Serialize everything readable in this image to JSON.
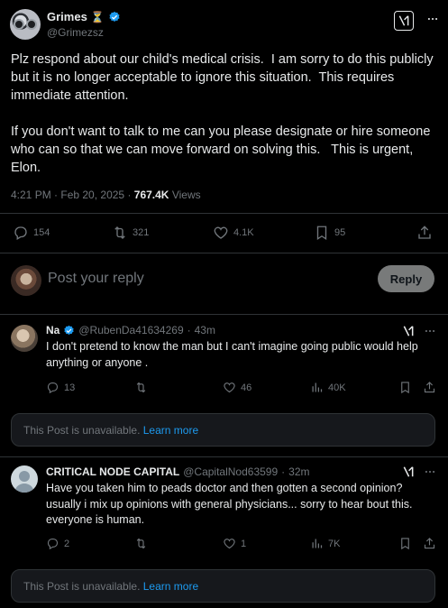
{
  "post": {
    "author_name": "Grimes",
    "author_emoji": "⏳",
    "handle": "@Grimezsz",
    "paragraph1": "Plz respond about our child's medical crisis.  I am sorry to do this publicly but it is no longer acceptable to ignore this situation.  This requires immediate attention.",
    "paragraph2": "If you don't want to talk to me can you please designate or hire someone who can so that we can move forward on solving this.   This is urgent, Elon.",
    "time": "4:21 PM",
    "date": "Feb 20, 2025",
    "views_count": "767.4K",
    "views_label": "Views",
    "replies": "154",
    "reposts": "321",
    "likes": "4.1K",
    "bookmarks": "95"
  },
  "reply_box": {
    "placeholder": "Post your reply",
    "button_label": "Reply"
  },
  "replies": [
    {
      "name": "Na",
      "handle": "@RubenDa41634269",
      "time": "43m",
      "text": "I don't pretend to know the man but I can't imagine going public would help anything or anyone .",
      "replies": "13",
      "reposts": "",
      "likes": "46",
      "views": "40K"
    },
    {
      "name": "CRITICAL NODE CAPITAL",
      "handle": "@CapitalNod63599",
      "time": "32m",
      "text": "Have you taken him to peads doctor and then gotten a second opinion? usually i mix up opinions with general physicians... sorry to hear bout this. everyone is human.",
      "replies": "2",
      "reposts": "",
      "likes": "1",
      "views": "7K"
    }
  ],
  "unavailable": {
    "text": "This Post is unavailable.",
    "link": "Learn more"
  },
  "colors": {
    "background": "#000000",
    "text": "#e7e9ea",
    "muted": "#71767b",
    "link": "#1d9bf0",
    "verified": "#1d9bf0",
    "divider": "#2f3336"
  }
}
